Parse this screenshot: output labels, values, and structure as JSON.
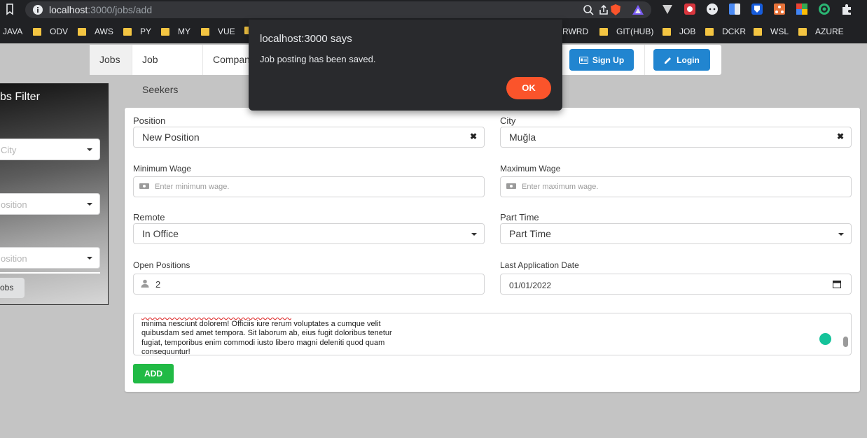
{
  "browser": {
    "url_host": "localhost",
    "url_rest": ":3000/jobs/add",
    "bookmarks": [
      "JAVA",
      "ODV",
      "AWS",
      "PY",
      "MY",
      "VUE",
      "RWRD",
      "GIT(HUB)",
      "JOB",
      "DCKR",
      "WSL",
      "AZURE"
    ]
  },
  "navbar": {
    "items": [
      "Jobs",
      "Job Seekers",
      "Compan"
    ],
    "signup_label": "Sign Up",
    "login_label": "Login"
  },
  "filter": {
    "title": "bs Filter",
    "city_placeholder": "City",
    "position_placeholder": "osition",
    "position2_placeholder": "osition",
    "button_label": "obs"
  },
  "form": {
    "position_label": "Position",
    "position_value": "New Position",
    "city_label": "City",
    "city_value": "Muğla",
    "min_wage_label": "Minimum Wage",
    "min_wage_placeholder": "Enter minimum wage.",
    "max_wage_label": "Maximum Wage",
    "max_wage_placeholder": "Enter maximum wage.",
    "remote_label": "Remote",
    "remote_value": "In Office",
    "part_time_label": "Part Time",
    "part_time_value": "Part Time",
    "open_positions_label": "Open Positions",
    "open_positions_value": "2",
    "last_date_label": "Last Application Date",
    "last_date_value": "01/01/2022",
    "description_lines": [
      "minima nesciunt dolorem! Officiis iure rerum voluptates a cumque velit",
      "quibusdam sed amet tempora. Sit laborum ab, eius fugit doloribus tenetur",
      "fugiat, temporibus enim commodi iusto libero magni deleniti quod quam",
      "consequuntur!"
    ],
    "add_label": "ADD"
  },
  "dialog": {
    "title": "localhost:3000 says",
    "message": "Job posting has been saved.",
    "ok_label": "OK"
  },
  "colors": {
    "primary_button": "#2185d0",
    "add_button": "#21ba45",
    "ok_button": "#fb542b"
  }
}
